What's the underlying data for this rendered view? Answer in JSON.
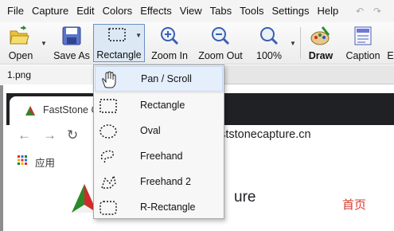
{
  "menubar": {
    "items": [
      "File",
      "Capture",
      "Edit",
      "Colors",
      "Effects",
      "View",
      "Tabs",
      "Tools",
      "Settings",
      "Help"
    ],
    "undo_icon": "undo-icon",
    "redo_icon": "redo-icon"
  },
  "toolbar": {
    "open": "Open",
    "save_as": "Save As",
    "rectangle": "Rectangle",
    "zoom_in": "Zoom In",
    "zoom_out": "Zoom Out",
    "zoom_level": "100%",
    "draw": "Draw",
    "caption": "Caption",
    "overflow": "E"
  },
  "tabs": {
    "file_tab": "1.png"
  },
  "selection_menu": {
    "items": [
      {
        "label": "Pan / Scroll",
        "icon": "hand-icon",
        "highlighted": true
      },
      {
        "label": "Rectangle",
        "icon": "rectangle-select-icon"
      },
      {
        "label": "Oval",
        "icon": "oval-select-icon"
      },
      {
        "label": "Freehand",
        "icon": "freehand-select-icon"
      },
      {
        "label": "Freehand 2",
        "icon": "freehand2-select-icon"
      },
      {
        "label": "R-Rectangle",
        "icon": "rounded-rectangle-select-icon"
      }
    ]
  },
  "canvas": {
    "browser_tab_title": "FastStone Ca",
    "url": "faststonecapture.cn",
    "apps_label": "应用",
    "page_title_fragment": "ure",
    "homepage_link": "首页"
  },
  "colors": {
    "accent": "#6a8fc4",
    "highlight": "#e5eefb",
    "homepage": "#d9392c"
  }
}
